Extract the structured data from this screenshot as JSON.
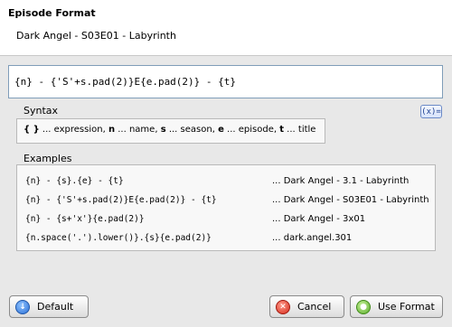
{
  "window": {
    "title": "Episode Format",
    "subtitle": "Dark Angel - S03E01 - Labyrinth"
  },
  "expression": {
    "value": "{n} - {'S'+s.pad(2)}E{e.pad(2)} - {t}"
  },
  "syntax": {
    "label": "Syntax",
    "help_button": "(x)=",
    "items": [
      {
        "token": "{ }",
        "desc": " ... expression, "
      },
      {
        "token": "n",
        "desc": " ... name, "
      },
      {
        "token": "s",
        "desc": " ... season, "
      },
      {
        "token": "e",
        "desc": " ... episode, "
      },
      {
        "token": "t",
        "desc": " ... title"
      }
    ]
  },
  "examples": {
    "label": "Examples",
    "rows": [
      {
        "code": "{n} - {s}.{e} - {t}",
        "result": "... Dark Angel - 3.1 - Labyrinth"
      },
      {
        "code": "{n} - {'S'+s.pad(2)}E{e.pad(2)} - {t}",
        "result": "... Dark Angel - S03E01 - Labyrinth"
      },
      {
        "code": "{n} - {s+'x'}{e.pad(2)}",
        "result": "... Dark Angel - 3x01"
      },
      {
        "code": "{n.space('.').lower()}.{s}{e.pad(2)}",
        "result": "... dark.angel.301"
      }
    ]
  },
  "buttons": {
    "default": "Default",
    "cancel": "Cancel",
    "use": "Use Format"
  },
  "icons": {
    "default": "arrow-down-icon",
    "cancel": "cancel-icon",
    "use": "confirm-icon"
  }
}
